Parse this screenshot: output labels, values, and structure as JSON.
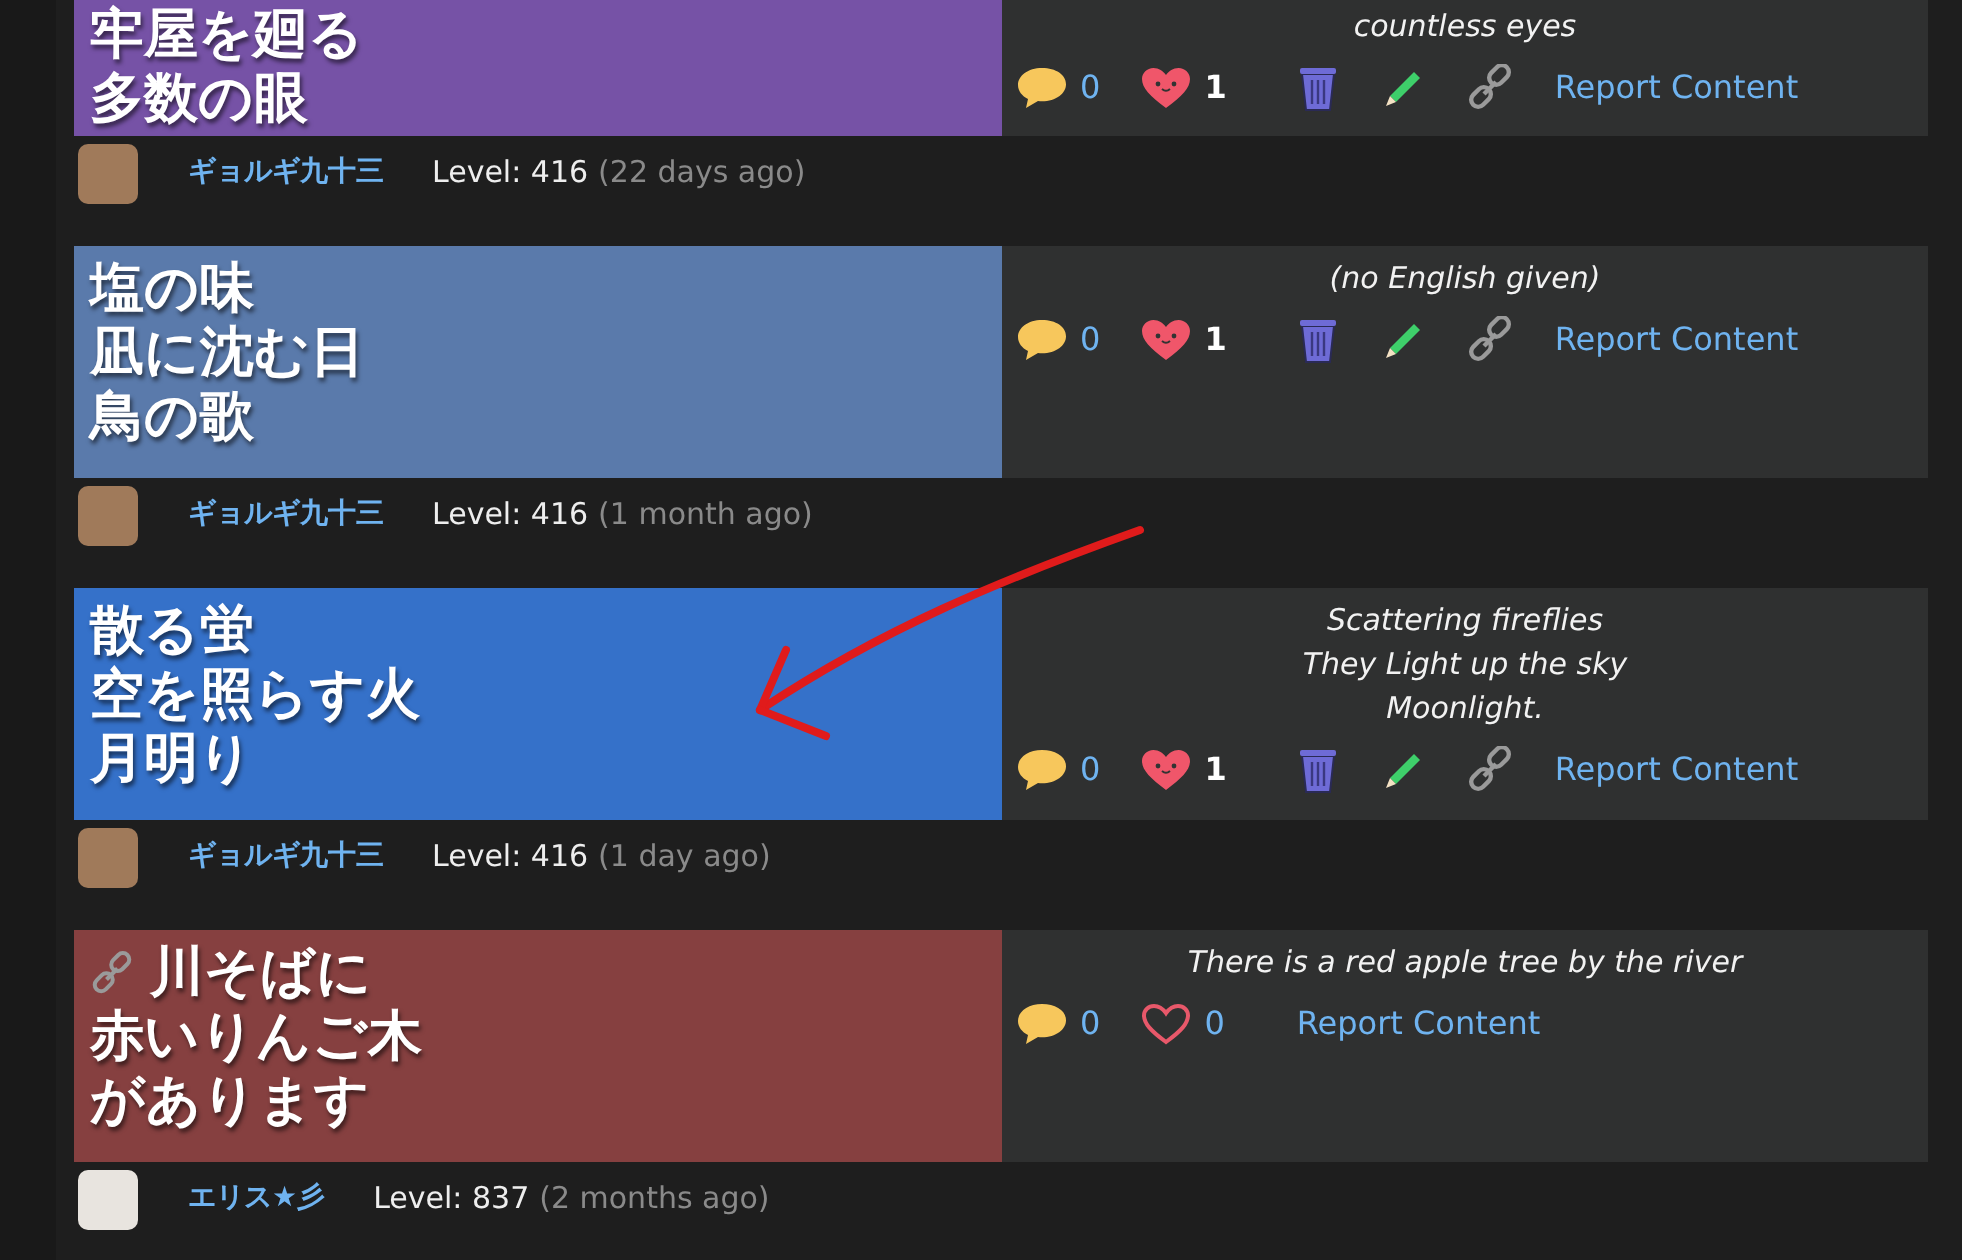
{
  "posts": [
    {
      "cut_off_top": true,
      "color": "#7652a6",
      "poem_link": false,
      "poem": [
        "牢屋を廻る",
        "多数の眼"
      ],
      "english": [
        "countless eyes"
      ],
      "comments": "0",
      "likes": "1",
      "liked": true,
      "owner_tools": true,
      "report": "Report Content",
      "user": "ギョルギ九十三",
      "level": "Level: 416",
      "when": "(22 days ago)"
    },
    {
      "cut_off_top": false,
      "color": "#5a7aab",
      "poem_link": false,
      "poem": [
        "塩の味",
        "凪に沈む日",
        "鳥の歌"
      ],
      "english": [
        "(no English given)"
      ],
      "comments": "0",
      "likes": "1",
      "liked": true,
      "owner_tools": true,
      "report": "Report Content",
      "user": "ギョルギ九十三",
      "level": "Level: 416",
      "when": "(1 month ago)"
    },
    {
      "cut_off_top": false,
      "color": "#3571c9",
      "poem_link": false,
      "poem": [
        "散る蛍",
        "空を照らす火",
        "月明り"
      ],
      "english": [
        "Scattering fireflies",
        "They Light up the sky",
        "Moonlight."
      ],
      "comments": "0",
      "likes": "1",
      "liked": true,
      "owner_tools": true,
      "report": "Report Content",
      "user": "ギョルギ九十三",
      "level": "Level: 416",
      "when": "(1 day ago)"
    },
    {
      "cut_off_top": false,
      "color": "#864040",
      "poem_link": true,
      "poem": [
        "川そばに",
        "赤いりんご木",
        "があります"
      ],
      "english": [
        "There is a red apple tree by the river"
      ],
      "comments": "0",
      "likes": "0",
      "liked": false,
      "owner_tools": false,
      "report": "Report Content",
      "user": "エリス★彡",
      "level": "Level: 837",
      "when": "(2 months ago)"
    }
  ]
}
